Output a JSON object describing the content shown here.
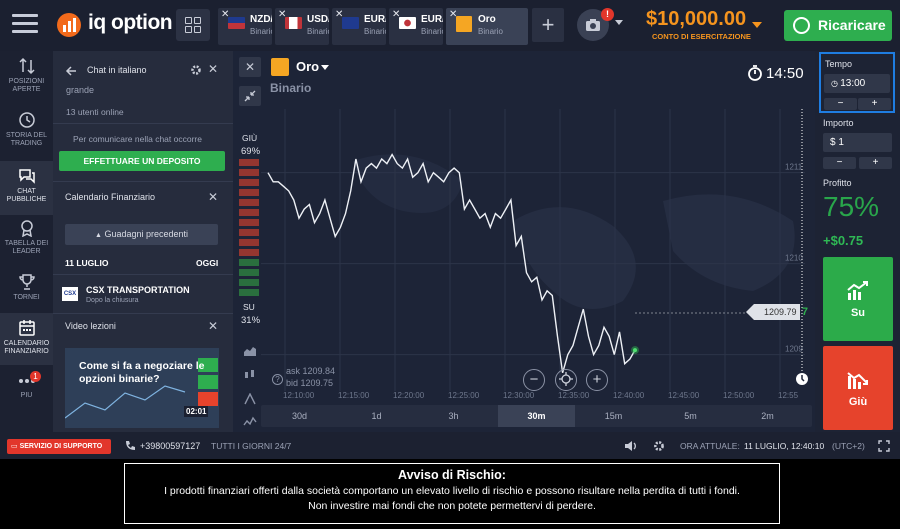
{
  "brand": {
    "logo_text": "iq option"
  },
  "tabs": [
    {
      "name": "NZD/USD",
      "sub": "Binario",
      "active": false
    },
    {
      "name": "USD/CAD",
      "sub": "Binario",
      "active": false
    },
    {
      "name": "EUR/AUD",
      "sub": "Binario",
      "active": false
    },
    {
      "name": "EUR/JPY",
      "sub": "Binario",
      "active": false
    },
    {
      "name": "Oro",
      "sub": "Binario",
      "active": true
    }
  ],
  "header": {
    "notification_count": "!",
    "balance": "$10,000.00",
    "account_label": "CONTO DI ESERCITAZIONE",
    "recharge_label": "Ricaricare"
  },
  "leftnav": [
    {
      "icon": "arrows-updown-icon",
      "label_1": "POSIZIONI",
      "label_2": "APERTE",
      "active": false
    },
    {
      "icon": "history-icon",
      "label_1": "STORIA DEL",
      "label_2": "TRADING",
      "active": false
    },
    {
      "icon": "chat-icon",
      "label_1": "CHAT",
      "label_2": "PUBBLICHE",
      "active": true
    },
    {
      "icon": "leaderboard-icon",
      "label_1": "TABELLA DEI",
      "label_2": "LEADER",
      "active": false
    },
    {
      "icon": "trophy-icon",
      "label_1": "TORNEI",
      "label_2": "",
      "active": false
    },
    {
      "icon": "calendar-icon",
      "label_1": "CALENDARIO",
      "label_2": "FINANZIARIO",
      "active": true
    },
    {
      "icon": "more-icon",
      "label_1": "PIU",
      "label_2": "",
      "badge": "1",
      "active": false
    }
  ],
  "chat": {
    "title": "Chat in italiano",
    "room_size": "grande",
    "users_online": "13 utenti online",
    "info_text": "Per comunicare nella chat occorre",
    "deposit_label": "EFFETTUARE UN DEPOSITO"
  },
  "calendar": {
    "title": "Calendario Finanziario",
    "prev_label": "Guadagni precedenti",
    "date_label": "11 LUGLIO",
    "today_label": "OGGI",
    "event_logo": "CSX",
    "event_name": "CSX TRANSPORTATION",
    "event_sub": "Dopo la chiusura"
  },
  "video": {
    "title": "Video lezioni",
    "caption_1": "Come si fa a negoziare le",
    "caption_2": "opzioni binarie?",
    "duration": "02:01"
  },
  "chart": {
    "asset_name": "Oro",
    "asset_type": "Binario",
    "timer": "14:50",
    "down_label": "GIÙ",
    "down_pct": "69%",
    "up_label": "SU",
    "up_pct": "31%",
    "ask": "ask 1209.84",
    "bid": "bid 1209.75",
    "price": "1209.79",
    "price_last": "7",
    "y_ticks": [
      "1211",
      "1210",
      "1209"
    ],
    "x_ticks": [
      "12:10:00",
      "12:15:00",
      "12:20:00",
      "12:25:00",
      "12:30:00",
      "12:35:00",
      "12:40:00",
      "12:45:00",
      "12:50:00",
      "12:55"
    ],
    "timeframes": [
      "30d",
      "1d",
      "3h",
      "30m",
      "15m",
      "5m",
      "2m"
    ],
    "active_timeframe": "30m"
  },
  "chart_data": {
    "type": "line",
    "title": "",
    "xlabel": "",
    "ylabel": "",
    "y": [
      1211.0,
      1210.9,
      1210.9,
      1210.85,
      1210.8,
      1210.7,
      1210.5,
      1210.6,
      1210.65,
      1210.45,
      1210.55,
      1210.7,
      1210.5,
      1210.3,
      1210.4,
      1210.55,
      1210.8,
      1211.15,
      1210.9,
      1211.05,
      1211.1,
      1211.05,
      1211.15,
      1211.1,
      1211.2,
      1211.1,
      1211.05,
      1211.15,
      1210.95,
      1211.0,
      1211.1,
      1210.9,
      1211.0,
      1210.95,
      1210.9,
      1211.0,
      1211.05,
      1211.0,
      1210.6,
      1210.7,
      1210.6,
      1210.5,
      1210.55,
      1210.4,
      1210.55,
      1210.5,
      1210.6,
      1210.7,
      1210.2,
      1210.3,
      1209.9,
      1209.8,
      1209.85,
      1209.6,
      1209.7,
      1209.65,
      1209.2,
      1208.8,
      1209.0,
      1209.1,
      1209.3,
      1209.5,
      1209.2,
      1209.0,
      1209.1,
      1209.3,
      1209.2,
      1209.0,
      1209.25,
      1208.9,
      1208.95,
      1209.05
    ],
    "ylim": [
      1208.6,
      1211.7
    ],
    "grid": true
  },
  "trade": {
    "time_label": "Tempo",
    "time_value": "13:00",
    "amount_label": "Importo",
    "amount_value": "$  1",
    "profit_label": "Profitto",
    "profit_pct": "75%",
    "profit_amount": "+$0.75",
    "up_label": "Su",
    "down_label": "Giù"
  },
  "status": {
    "support_label": "SERVIZIO DI SUPPORTO",
    "phone": "+39800597127",
    "hours": "TUTTI I GIORNI 24/7",
    "current_time_label": "ORA ATTUALE:",
    "current_time": "11 LUGLIO, 12:40:10",
    "utc": "(UTC+2)"
  },
  "risk": {
    "title": "Avviso di Rischio:",
    "line_1": "I prodotti finanziari offerti dalla società comportano un elevato livello di rischio e possono risultare nella perdita di tutti i fondi.",
    "line_2": "Non investire mai fondi che non potete permettervi di perdere."
  },
  "colors": {
    "accent_green": "#2eae4f",
    "accent_red": "#e6432c",
    "balance_orange": "#f5941e",
    "highlight_blue": "#1f7de1"
  }
}
